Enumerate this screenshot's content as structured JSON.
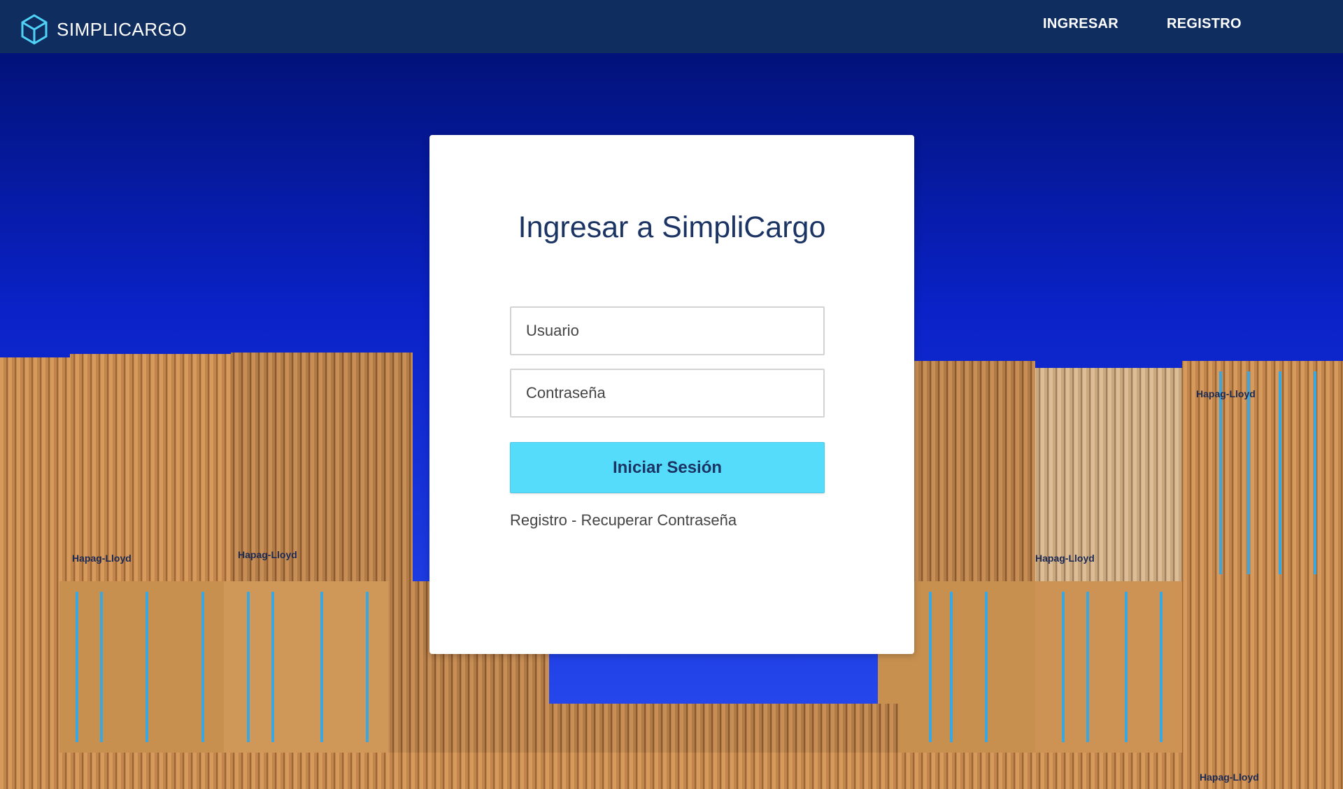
{
  "navbar": {
    "brand": "SIMPLICARGO",
    "links": [
      {
        "label": "INGRESAR"
      },
      {
        "label": "REGISTRO"
      }
    ]
  },
  "login": {
    "title": "Ingresar a SimpliCargo",
    "username_placeholder": "Usuario",
    "password_placeholder": "Contraseña",
    "submit_label": "Iniciar Sesión",
    "register_link": "Registro",
    "separator": " - ",
    "recover_link": "Recuperar Contraseña"
  },
  "background": {
    "container_brand": "Hapag-Lloyd"
  },
  "colors": {
    "navbar": "#0f2d5e",
    "sky_top": "#02127a",
    "sky_bottom": "#2a4ef2",
    "button": "#56dcfb",
    "title_text": "#1b3464",
    "logo_accent": "#4fd2f5",
    "container_orange": "#c88a4e"
  }
}
